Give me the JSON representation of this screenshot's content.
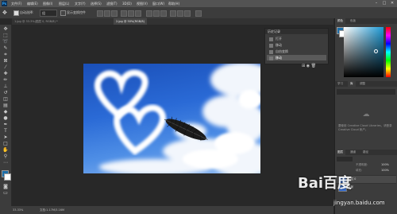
{
  "app": {
    "logo_text": "Ps"
  },
  "menu": {
    "items": [
      "文件(F)",
      "编辑(E)",
      "图像(I)",
      "图层(L)",
      "文字(Y)",
      "选择(S)",
      "滤镜(T)",
      "3D(D)",
      "视图(V)",
      "窗口(W)",
      "帮助(H)"
    ]
  },
  "window_controls": {
    "minimize": "–",
    "maximize": "□",
    "close": "✕"
  },
  "options": {
    "auto_select_label": "自动选择:",
    "auto_select_value": "组",
    "show_transform_label": "显示变换控件"
  },
  "tabs": [
    {
      "label": "1.jpg @ 33.3%(图层 0, RGB/8) *",
      "active": false
    },
    {
      "label": "2.jpg @ 50%(RGB/8)",
      "active": true
    }
  ],
  "history_panel": {
    "title": "历史记录",
    "items": [
      {
        "label": "打开",
        "selected": false
      },
      {
        "label": "移动",
        "selected": false
      },
      {
        "label": "自由变换",
        "selected": false
      },
      {
        "label": "移动",
        "selected": true
      }
    ]
  },
  "right_panels": {
    "color_tab": "颜色",
    "swatch_tab": "色板",
    "library_tabs": [
      "学习",
      "库",
      "调整"
    ],
    "library_empty_text": "要使用 Creative Cloud Libraries，请登录 Creative Cloud 帐户。",
    "layers_tabs": [
      "图层",
      "通道",
      "路径"
    ],
    "layer_rows": [
      {
        "name": "图层 0"
      },
      {
        "name": "背景"
      }
    ],
    "opacity_label": "不透明度:",
    "opacity_value": "100%",
    "fill_label": "填充:",
    "fill_value": "100%"
  },
  "status": {
    "zoom": "33.33%",
    "doc_info": "文档:1.17M/3.16M"
  },
  "colors": {
    "foreground": "#1d6ea8",
    "background": "#ffffff"
  },
  "watermark": {
    "brand": "Bai百度",
    "url": "jingyan.baidu.com"
  }
}
